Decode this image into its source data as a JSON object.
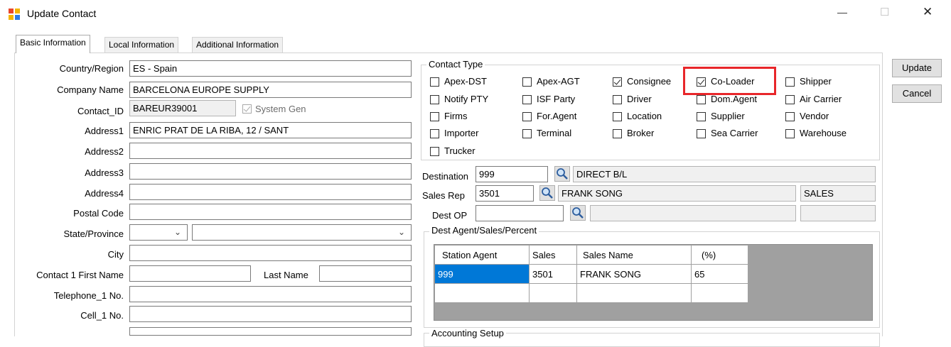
{
  "window": {
    "title": "Update Contact",
    "icon": "app-icon",
    "controls": {
      "minimize": "—",
      "maximize": "☐",
      "close": "✕"
    }
  },
  "tabs": [
    "Basic Information",
    "Local Information",
    "Additional Information"
  ],
  "form": {
    "country_label": "Country/Region",
    "country_value": "ES - Spain",
    "company_label": "Company Name",
    "company_value": "BARCELONA EUROPE SUPPLY",
    "contact_id_label": "Contact_ID",
    "contact_id_value": "BAREUR39001",
    "system_gen_label": "System Gen",
    "address1_label": "Address1",
    "address1_value": "ENRIC PRAT DE LA RIBA, 12 / SANT",
    "address2_label": "Address2",
    "address3_label": "Address3",
    "address4_label": "Address4",
    "postal_label": "Postal Code",
    "state_label": "State/Province",
    "city_label": "City",
    "first_name_label": "Contact 1 First Name",
    "last_name_label": "Last Name",
    "telephone_label": "Telephone_1 No.",
    "cell_label": "Cell_1 No."
  },
  "contact_type": {
    "title": "Contact Type",
    "items": [
      {
        "label": "Apex-DST",
        "checked": false
      },
      {
        "label": "Apex-AGT",
        "checked": false
      },
      {
        "label": "Consignee",
        "checked": true
      },
      {
        "label": "Co-Loader",
        "checked": true
      },
      {
        "label": "Shipper",
        "checked": false
      },
      {
        "label": "Notify PTY",
        "checked": false
      },
      {
        "label": "ISF Party",
        "checked": false
      },
      {
        "label": "Driver",
        "checked": false
      },
      {
        "label": "Dom.Agent",
        "checked": false
      },
      {
        "label": "Air Carrier",
        "checked": false
      },
      {
        "label": "Firms",
        "checked": false
      },
      {
        "label": "For.Agent",
        "checked": false
      },
      {
        "label": "Location",
        "checked": false
      },
      {
        "label": "Supplier",
        "checked": false
      },
      {
        "label": "Vendor",
        "checked": false
      },
      {
        "label": "Importer",
        "checked": false
      },
      {
        "label": "Terminal",
        "checked": false
      },
      {
        "label": "Broker",
        "checked": false
      },
      {
        "label": "Sea Carrier",
        "checked": false
      },
      {
        "label": "Warehouse",
        "checked": false
      },
      {
        "label": "Trucker",
        "checked": false
      }
    ],
    "highlight_color": "#e8262a"
  },
  "destination": {
    "label": "Destination",
    "code": "999",
    "name": "DIRECT B/L"
  },
  "sales_rep": {
    "label": "Sales Rep",
    "code": "3501",
    "name": "FRANK SONG",
    "dept": "SALES"
  },
  "dest_op": {
    "label": "Dest OP"
  },
  "dest_agent": {
    "title": "Dest Agent/Sales/Percent",
    "columns": [
      "Station Agent",
      "Sales",
      "Sales Name",
      "(%)"
    ],
    "rows": [
      [
        "999",
        "3501",
        "FRANK SONG",
        "65"
      ]
    ]
  },
  "accounting_setup_title": "Accounting Setup",
  "buttons": {
    "update": "Update",
    "cancel": "Cancel"
  },
  "colors": {
    "selection": "#0078d7",
    "grid_bg": "#a0a0a0"
  }
}
